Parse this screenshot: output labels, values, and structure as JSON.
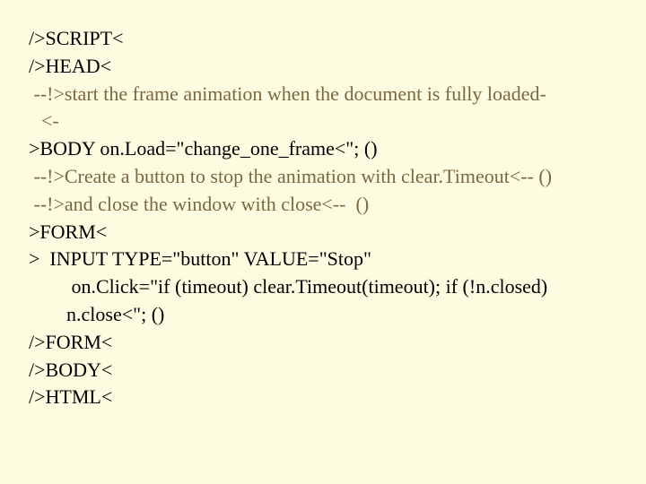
{
  "lines": {
    "l1": "/>SCRIPT<",
    "l2": "/>HEAD<",
    "l3": " --!>start the frame animation when the document is fully loaded-",
    "l3b": "<-",
    "l4": ">BODY on.Load=\"change_one_frame<\"; ()",
    "l5": " --!>Create a button to stop the animation with clear.Timeout<-- ()",
    "l6": " --!>and close the window with close<--  ()",
    "l7": ">FORM<",
    "l8": ">  INPUT TYPE=\"button\" VALUE=\"Stop\"",
    "l9": " on.Click=\"if (timeout) clear.Timeout(timeout); if (!n.closed)",
    "l10": "n.close<\"; ()",
    "l11": "/>FORM<",
    "l12": "/>BODY<",
    "l13": "/>HTML<"
  }
}
